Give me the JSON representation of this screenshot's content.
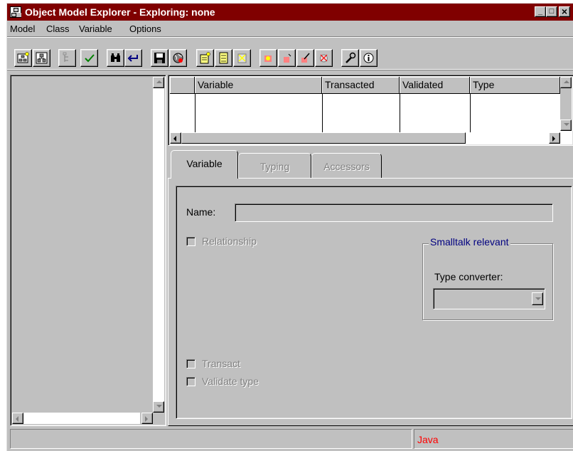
{
  "window": {
    "title": "Object Model Explorer - Exploring: none",
    "minimize": "_",
    "maximize": "□",
    "close": "×"
  },
  "menu": [
    "Model",
    "Class",
    "Variable",
    "Options"
  ],
  "toolbar": {
    "buttons": [
      "new-model-icon",
      "model-icon",
      "hierarchy-icon",
      "check-icon",
      "binoculars-icon",
      "return-icon",
      "save-icon",
      "globe-icon",
      "new-class-icon",
      "class-icon",
      "class-sparkle-icon",
      "new-variable-icon",
      "variable-icon",
      "variable-edit-icon",
      "variable-sparkle-icon",
      "wrench-icon",
      "info-icon"
    ]
  },
  "table": {
    "columns": [
      "Variable",
      "Transacted",
      "Validated",
      "Type"
    ]
  },
  "tabs": [
    "Variable",
    "Typing",
    "Accessors"
  ],
  "form": {
    "name_label": "Name:",
    "name_value": "",
    "relationship_label": "Relationship",
    "smalltalk_group": "Smalltalk relevant",
    "type_converter_label": "Type converter:",
    "type_converter_value": "",
    "transact_label": "Transact",
    "validate_label": "Validate type"
  },
  "status": {
    "left": "",
    "right": "Java"
  },
  "colors": {
    "titlebar": "#800000",
    "group_label": "#000080",
    "status_text": "#ff0000",
    "face": "#c0c0c0"
  }
}
